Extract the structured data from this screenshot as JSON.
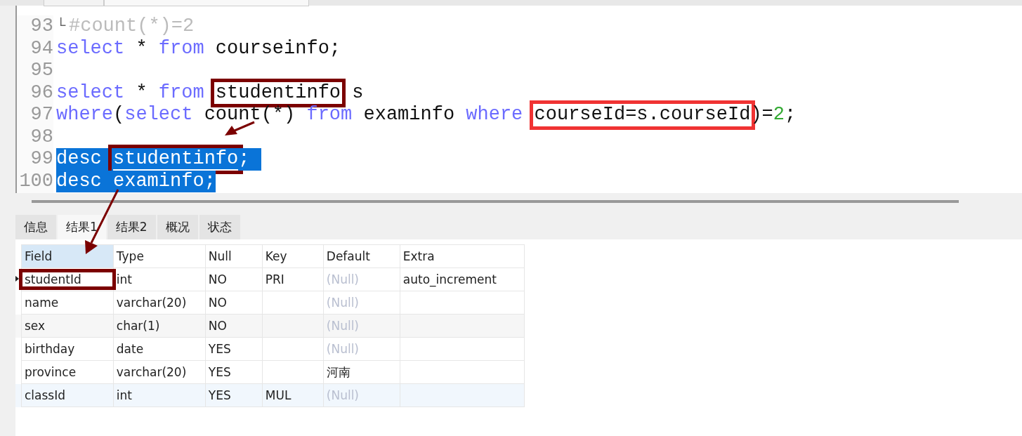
{
  "editor": {
    "lines": [
      {
        "number": "93",
        "marker": "└",
        "selected": false,
        "tokens": [
          {
            "text": "#count(*)=2",
            "kind": "comment"
          }
        ]
      },
      {
        "number": "94",
        "selected": false,
        "tokens": [
          {
            "text": "select",
            "kind": "keyword"
          },
          {
            "text": " * ",
            "kind": "plain"
          },
          {
            "text": "from",
            "kind": "keyword"
          },
          {
            "text": " courseinfo;",
            "kind": "plain"
          }
        ]
      },
      {
        "number": "95",
        "selected": false
      },
      {
        "number": "96",
        "selected": false,
        "tokens": [
          {
            "text": "select",
            "kind": "keyword"
          },
          {
            "text": " * ",
            "kind": "plain"
          },
          {
            "text": "from ",
            "kind": "keyword"
          },
          {
            "text": "studentinfo",
            "kind": "plain",
            "color": "#7b0000"
          },
          {
            "text": " s",
            "kind": "plain"
          }
        ]
      },
      {
        "number": "97",
        "selected": false,
        "tokens": [
          {
            "text": "where",
            "kind": "keyword"
          },
          {
            "text": "(",
            "kind": "plain"
          },
          {
            "text": "select",
            "kind": "keyword"
          },
          {
            "text": " count(*) ",
            "kind": "plain"
          },
          {
            "text": "from",
            "kind": "keyword"
          },
          {
            "text": " examinfo ",
            "kind": "plain"
          },
          {
            "text": "where ",
            "kind": "keyword"
          },
          {
            "text": "courseId=s.courseId",
            "kind": "plain",
            "color": "#f03333"
          },
          {
            "text": ")=",
            "kind": "plain"
          },
          {
            "text": "2",
            "kind": "number"
          },
          {
            "text": ";",
            "kind": "plain"
          }
        ]
      },
      {
        "number": "98",
        "selected": false
      },
      {
        "number": "99",
        "selected": true,
        "tokens": [
          {
            "text": "desc ",
            "kind": "keyword"
          },
          {
            "text": "studentinfo",
            "kind": "plain",
            "color": "#7b0000"
          },
          {
            "text": "; ",
            "kind": "plain"
          }
        ]
      },
      {
        "number": "100",
        "selected": true,
        "tokens": [
          {
            "text": "desc",
            "kind": "keyword"
          },
          {
            "text": " examinfo;",
            "kind": "plain"
          }
        ]
      }
    ]
  },
  "result_tabs": [
    {
      "label": "信息",
      "selected": false
    },
    {
      "label": "结果1",
      "selected": true
    },
    {
      "label": "结果2",
      "selected": false
    },
    {
      "label": "概况",
      "selected": false
    },
    {
      "label": "状态",
      "selected": false
    }
  ],
  "table": {
    "columns": [
      {
        "label": "Field",
        "selected": true
      },
      {
        "label": "Type",
        "selected": false
      },
      {
        "label": "Null",
        "selected": false
      },
      {
        "label": "Key",
        "selected": false
      },
      {
        "label": "Default",
        "selected": false
      },
      {
        "label": "Extra",
        "selected": false
      }
    ],
    "rows": [
      {
        "current": true,
        "hovered": false,
        "field_boxed": true,
        "null_default": true,
        "cells": [
          "studentId",
          "int",
          "NO",
          "PRI",
          "(Null)",
          "auto_increment"
        ]
      },
      {
        "current": false,
        "hovered": false,
        "field_boxed": false,
        "null_default": true,
        "cells": [
          "name",
          "varchar(20)",
          "NO",
          "",
          "(Null)",
          ""
        ]
      },
      {
        "current": false,
        "hovered": false,
        "field_boxed": false,
        "null_default": true,
        "cells": [
          "sex",
          "char(1)",
          "NO",
          "",
          "(Null)",
          ""
        ]
      },
      {
        "current": false,
        "hovered": false,
        "field_boxed": false,
        "null_default": true,
        "cells": [
          "birthday",
          "date",
          "YES",
          "",
          "(Null)",
          ""
        ]
      },
      {
        "current": false,
        "hovered": false,
        "field_boxed": false,
        "null_default": false,
        "cells": [
          "province",
          "varchar(20)",
          "YES",
          "",
          "河南",
          ""
        ]
      },
      {
        "current": false,
        "hovered": true,
        "field_boxed": false,
        "null_default": true,
        "cells": [
          "classId",
          "int",
          "YES",
          "MUL",
          "(Null)",
          ""
        ]
      }
    ]
  }
}
